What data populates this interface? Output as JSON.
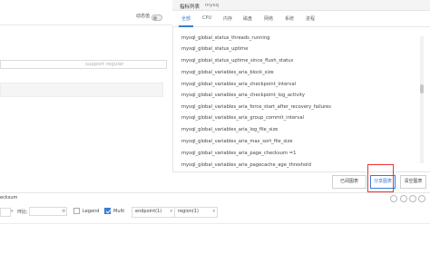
{
  "left": {
    "toggle_label": "动态值",
    "filter_placeholder": "support regular"
  },
  "right": {
    "title": "指标列表",
    "subtitle": "mysq",
    "tabs": [
      "全部",
      "CPU",
      "内存",
      "磁盘",
      "网络",
      "系统",
      "进程"
    ],
    "metrics": [
      "mysql_global_status_threads_running",
      "mysql_global_status_uptime",
      "mysql_global_status_uptime_since_flush_status",
      "mysql_global_variables_aria_block_size",
      "mysql_global_variables_aria_checkpoint_interval",
      "mysql_global_variables_aria_checkpoint_log_activity",
      "mysql_global_variables_aria_force_start_after_recovery_failures",
      "mysql_global_variables_aria_group_commit_interval",
      "mysql_global_variables_aria_log_file_size",
      "mysql_global_variables_aria_max_sort_file_size",
      "mysql_global_variables_aria_page_checksum =1",
      "mysql_global_variables_aria_pagecache_age_threshold"
    ],
    "buttons": {
      "view_metric": "已阅图表",
      "share_metric": "分享图表",
      "clear": "清空图表"
    }
  },
  "bottom": {
    "section_label": "ecksum",
    "compare_label": "环比:",
    "legend_label": "Legend",
    "multi_label": "Multi",
    "endpoint_select": "endpoint(1)",
    "region_select": "region(1)"
  },
  "colors": {
    "accent": "#3a7bd5",
    "highlight": "#e33333"
  }
}
